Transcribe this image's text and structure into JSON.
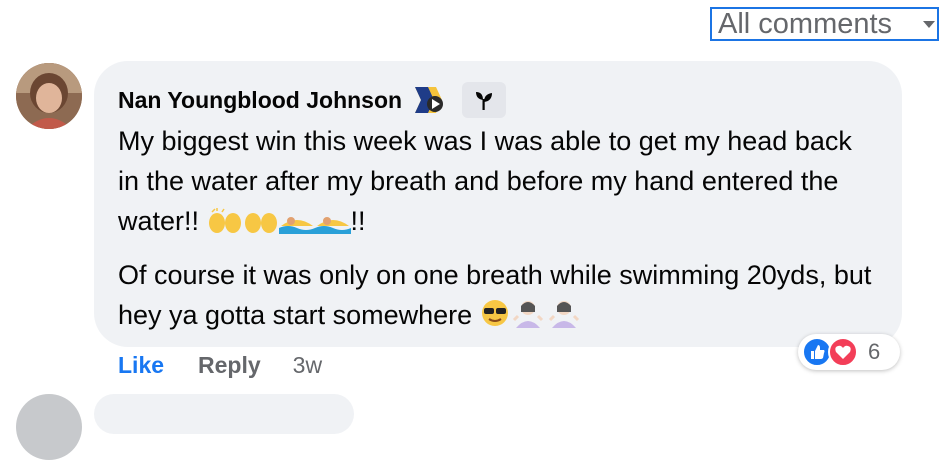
{
  "filter": {
    "label": "All comments"
  },
  "comment": {
    "author": "Nan Youngblood Johnson",
    "paragraph1": "My biggest win this week was I was able to get my head back in the water after my breath and before my hand entered the water!!",
    "paragraph1_suffix": "!!",
    "paragraph2": "Of course it was only on one breath while swimming 20yds, but hey ya gotta start somewhere",
    "timestamp": "3w",
    "reaction_count": "6"
  },
  "actions": {
    "like": "Like",
    "reply": "Reply"
  },
  "colors": {
    "link": "#1877f2",
    "muted": "#65676b",
    "bubble": "#f0f2f5",
    "love": "#f33e58"
  }
}
